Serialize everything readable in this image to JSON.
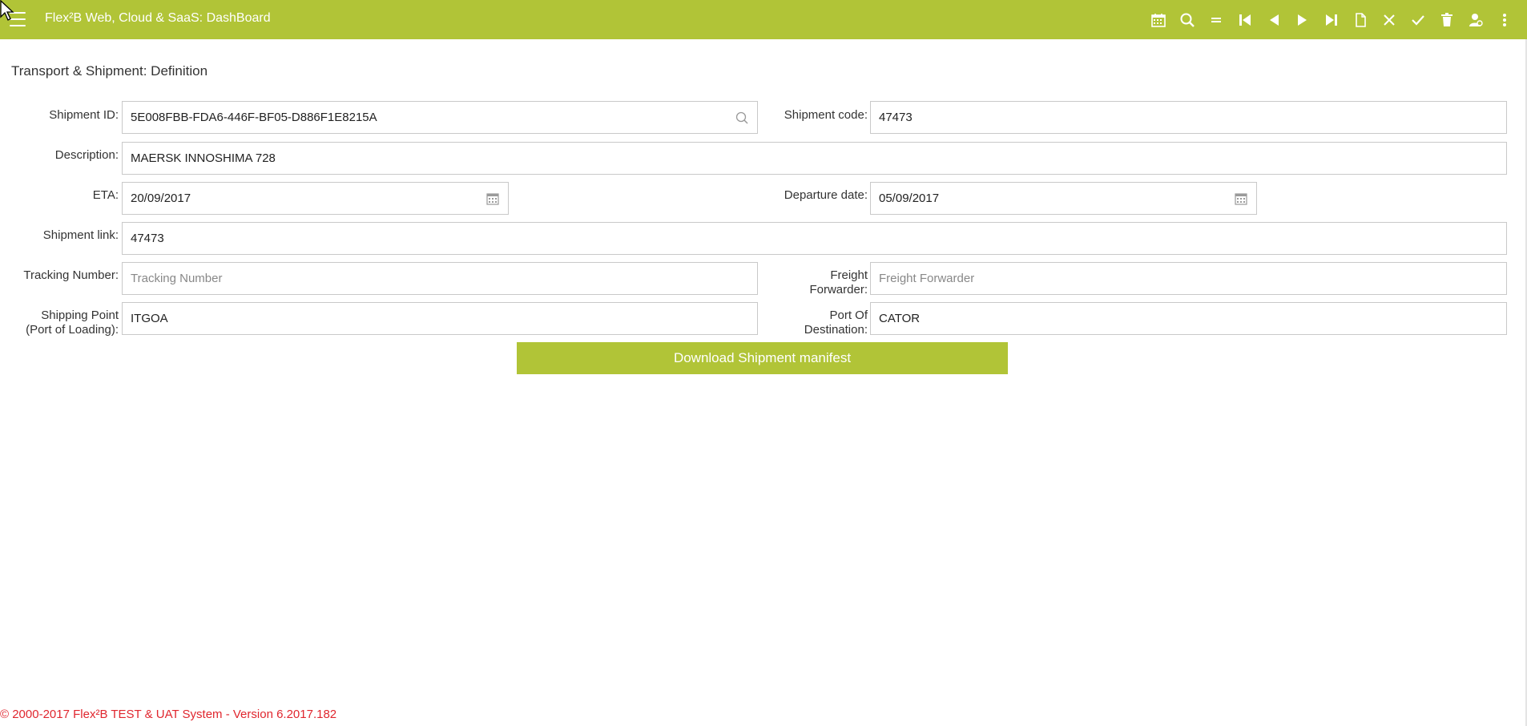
{
  "header": {
    "app_title": "Flex²B Web, Cloud & SaaS: DashBoard",
    "toolbar": [
      {
        "icon": "calendar-icon"
      },
      {
        "icon": "search-icon"
      },
      {
        "icon": "equals-icon"
      },
      {
        "icon": "first-record-icon"
      },
      {
        "icon": "previous-record-icon"
      },
      {
        "icon": "next-record-icon"
      },
      {
        "icon": "last-record-icon"
      },
      {
        "icon": "new-document-icon"
      },
      {
        "icon": "cancel-icon"
      },
      {
        "icon": "confirm-icon"
      },
      {
        "icon": "delete-icon"
      },
      {
        "icon": "user-settings-icon"
      },
      {
        "icon": "more-vertical-icon"
      }
    ],
    "accent_color": "#b1c437"
  },
  "page": {
    "title": "Transport & Shipment: Definition"
  },
  "form": {
    "shipment_id": {
      "label": "Shipment ID:",
      "value": "5E008FBB-FDA6-446F-BF05-D886F1E8215A"
    },
    "shipment_code": {
      "label": "Shipment code:",
      "value": "47473"
    },
    "description": {
      "label": "Description:",
      "value": "MAERSK INNOSHIMA 728"
    },
    "eta": {
      "label": "ETA:",
      "value": "20/09/2017"
    },
    "departure_date": {
      "label": "Departure date:",
      "value": "05/09/2017"
    },
    "shipment_link": {
      "label": "Shipment link:",
      "value": "47473"
    },
    "tracking_number": {
      "label": "Tracking Number:",
      "value": "",
      "placeholder": "Tracking Number"
    },
    "freight_forwarder": {
      "label_line1": "Freight",
      "label_line2": "Forwarder:",
      "value": "",
      "placeholder": "Freight Forwarder"
    },
    "shipping_point": {
      "label_line1": "Shipping Point",
      "label_line2": "(Port of Loading):",
      "value": "ITGOA"
    },
    "port_of_destination": {
      "label_line1": "Port Of",
      "label_line2": "Destination:",
      "value": "CATOR"
    },
    "download_button": "Download Shipment manifest"
  },
  "footer": {
    "text": "© 2000-2017 Flex²B TEST & UAT System - Version 6.2017.182",
    "color": "#e0262e"
  }
}
